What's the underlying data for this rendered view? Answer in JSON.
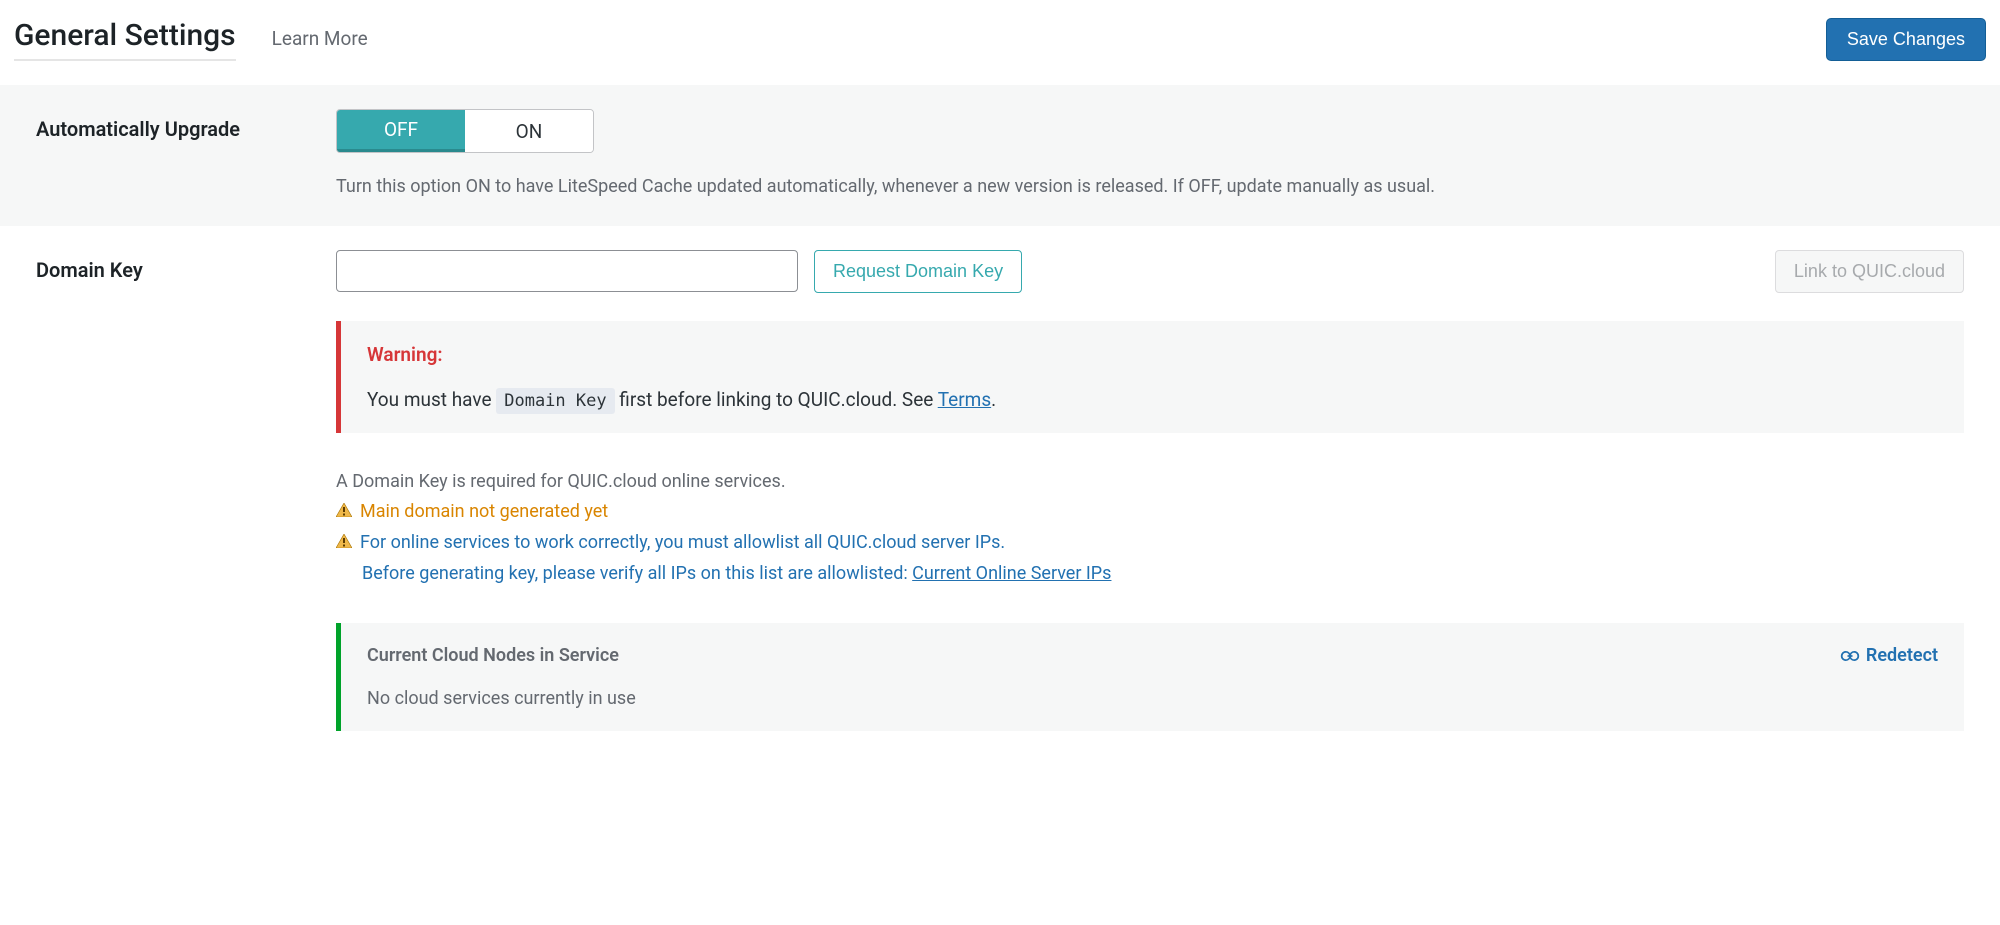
{
  "header": {
    "title": "General Settings",
    "learn_more": "Learn More",
    "save": "Save Changes"
  },
  "auto_upgrade": {
    "label": "Automatically Upgrade",
    "off": "OFF",
    "on": "ON",
    "selected": "OFF",
    "description": "Turn this option ON to have LiteSpeed Cache updated automatically, whenever a new version is released. If OFF, update manually as usual."
  },
  "domain_key": {
    "label": "Domain Key",
    "value": "",
    "request_btn": "Request Domain Key",
    "link_btn": "Link to QUIC.cloud",
    "warning": {
      "title": "Warning:",
      "prefix": "You must have ",
      "chip": "Domain Key",
      "mid": " first before linking to QUIC.cloud. See ",
      "link_text": "Terms",
      "suffix": "."
    },
    "info": {
      "line1": "A Domain Key is required for QUIC.cloud online services.",
      "line2": "Main domain not generated yet",
      "line3": "For online services to work correctly, you must allowlist all QUIC.cloud server IPs.",
      "line4a": "Before generating key, please verify all IPs on this list are allowlisted: ",
      "line4_link": "Current Online Server IPs"
    },
    "nodes": {
      "title": "Current Cloud Nodes in Service",
      "redetect": "Redetect",
      "body": "No cloud services currently in use"
    }
  }
}
